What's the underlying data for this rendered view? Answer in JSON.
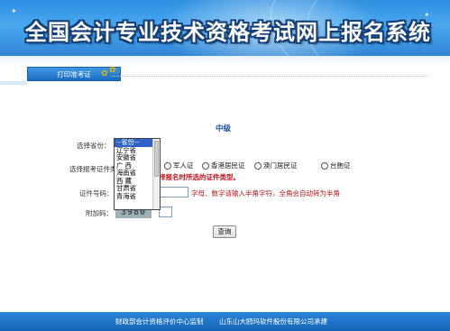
{
  "header": {
    "title": "全国会计专业技术资格考试网上报名系统"
  },
  "nav": {
    "print_tab_label": "打印准考证"
  },
  "form": {
    "level_title": "中级",
    "province_label": "选择省份：",
    "id_type_label": "选择报考证件类型：",
    "id_type_options": [
      "军人证",
      "香港居民证",
      "澳门居民证",
      "台胞证"
    ],
    "warning_visible": "择报名时所选的证件类型。",
    "id_number_label": "证件号码：",
    "id_number_value": "",
    "id_hint": "字母、数字请输入半角字符，全角会自动转为半角",
    "captcha_label": "附加码：",
    "captcha_text": "3980",
    "captcha_value": "",
    "query_button_label": "查询"
  },
  "province_dropdown": {
    "selected_index": 0,
    "options": [
      "--省份--",
      "辽宁省",
      "安徽省",
      "广 西",
      "海南省",
      "西 藏",
      "甘肃省",
      "青海省"
    ]
  },
  "footer": {
    "supervisor": "财政部会计资格评价中心监制",
    "developer": "山东山大鸥玛软件股份有限公司承建"
  },
  "colors": {
    "banner": "#2c8fe0",
    "footer": "#1563b8",
    "warning": "#c0141c",
    "accent_title": "#1c4f9a"
  }
}
